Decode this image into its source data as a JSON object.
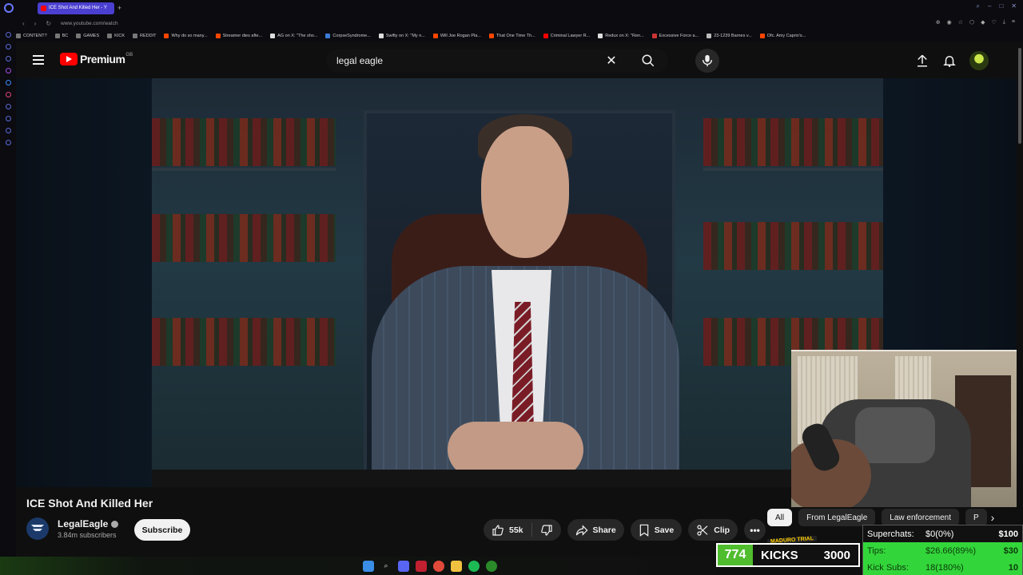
{
  "browser": {
    "tab_title": "ICE Shot And Killed Her - Y",
    "url": "www.youtube.com/watch",
    "bookmarks": [
      "CONTENT?",
      "BC",
      "GAMES",
      "KICK",
      "REDDIT",
      "Why do so many...",
      "Streamer dies afte...",
      "AG on X: \"The sho...",
      "CorpseSyndrome...",
      "Swifty on X: \"My n...",
      "Will Joe Rogan Pla...",
      "That One Time Th...",
      "Criminal Lawyer R...",
      "Redux on X: \"Ren...",
      "Excessive Force a...",
      "23-1239 Barnes v...",
      "Ofc. Amy Caprio's..."
    ]
  },
  "masthead": {
    "logo_text": "Premium",
    "country_code": "GB",
    "search_value": "legal eagle"
  },
  "video": {
    "title": "ICE Shot And Killed Her",
    "channel_name": "LegalEagle",
    "subscribers": "3.84m subscribers",
    "subscribe_label": "Subscribe",
    "likes": "55k",
    "share_label": "Share",
    "save_label": "Save",
    "clip_label": "Clip",
    "more_label": "•••"
  },
  "chips": {
    "items": [
      "All",
      "From LegalEagle",
      "Law enforcement",
      "P"
    ],
    "active": "All"
  },
  "overlay": {
    "kick_count": "774",
    "kicks_label": "KICKS",
    "kick_goal": "3000",
    "banner": "MADURO TRIAL",
    "goals": [
      {
        "label": "Superchats:",
        "value": "$0(0%)",
        "target": "$100",
        "progress": 0
      },
      {
        "label": "Tips:",
        "value": "$26.66(89%)",
        "target": "$30",
        "progress": 1
      },
      {
        "label": "Kick Subs:",
        "value": "18(180%)",
        "target": "10",
        "progress": 1
      }
    ]
  },
  "colors": {
    "youtube_red": "#ff0000",
    "goal_green": "#33d63a",
    "kick_green": "#4fbd2e"
  }
}
